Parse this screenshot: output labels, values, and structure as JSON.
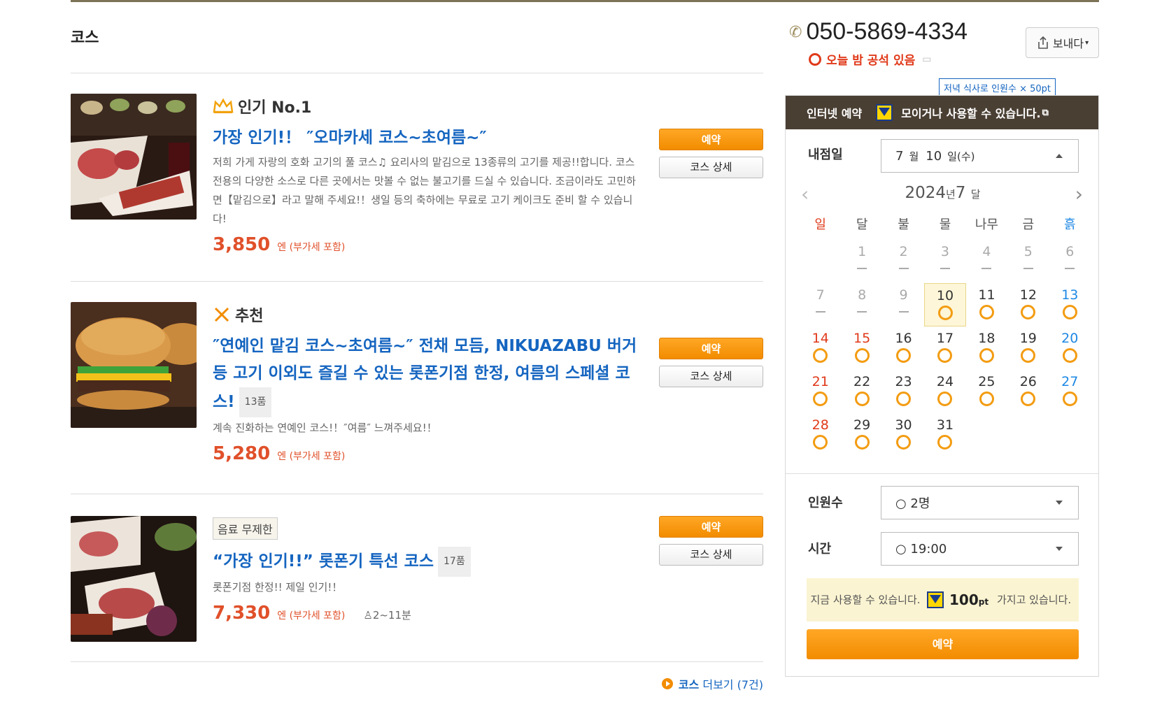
{
  "section": {
    "title": "코스"
  },
  "courses": [
    {
      "badge": "인기 No.1",
      "title": "가장 인기!！ ″오마카세 코스~초여름~″",
      "count": "",
      "desc": "저희 가게 자랑의 호화 고기의 풀 코스♫ 요리사의 맡김으로 13종류의 고기를 제공!!합니다. 코스 전용의 다양한 소스로 다른 곳에서는 맛볼 수 없는 불고기를 드실 수 있습니다. 조금이라도 고민하면【맡김으로】라고 말해 주세요!！생일 등의 축하에는 무료로 고기 케이크도 준비 할 수 있습니다!",
      "price": "3,850",
      "tax": "엔 (부가세 포함)",
      "people": "",
      "reserve": "예약",
      "detail": "코스 상세"
    },
    {
      "badge": "추천",
      "title": "″연예인 맡김 코스~초여름~″ 전채 모듬, NIKUAZABU 버거 등 고기 이외도 즐길 수 있는 롯폰기점 한정, 여름의 스페셜 코스!",
      "count": "13품",
      "desc": "계속 진화하는 연예인 코스!！″여름″ 느껴주세요!！",
      "price": "5,280",
      "tax": "엔 (부가세 포함)",
      "people": "",
      "reserve": "예약",
      "detail": "코스 상세"
    },
    {
      "badge": "음료 무제한",
      "title": "“가장 인기!!” 롯폰기 특선 코스",
      "count": "17품",
      "desc": "롯폰기점 한정!! 제일 인기!！",
      "price": "7,330",
      "tax": "엔 (부가세 포함)",
      "people": "2~11분",
      "reserve": "예약",
      "detail": "코스 상세"
    }
  ],
  "more": {
    "label": "코스",
    "text": "더보기 (7건)"
  },
  "contact": {
    "phone": "050-5869-4334",
    "vacancy": "오늘 밤 공석 있음",
    "share": "보내다"
  },
  "tooltip": "저녁 식사로 인원수 × 50pt",
  "panel": {
    "head_left": "인터넷 예약",
    "head_right": "모이거나 사용할 수 있습니다.",
    "date_label": "내점일",
    "date_month": "7",
    "date_month_unit": "월",
    "date_day": "10",
    "date_day_unit": "일(수)",
    "cal_year": "2024",
    "cal_year_unit": "년",
    "cal_month": "7",
    "cal_month_unit": "달",
    "weekdays": [
      "일",
      "달",
      "불",
      "물",
      "나무",
      "금",
      "흙"
    ],
    "weeks": [
      [
        "",
        "1",
        "2",
        "3",
        "4",
        "5",
        "6"
      ],
      [
        "7",
        "8",
        "9",
        "10",
        "11",
        "12",
        "13"
      ],
      [
        "14",
        "15",
        "16",
        "17",
        "18",
        "19",
        "20"
      ],
      [
        "21",
        "22",
        "23",
        "24",
        "25",
        "26",
        "27"
      ],
      [
        "28",
        "29",
        "30",
        "31",
        "",
        "",
        ""
      ]
    ],
    "people_label": "인원수",
    "people_value": "○ 2명",
    "time_label": "시간",
    "time_value": "○ 19:00",
    "points_pre": "지금 사용할 수 있습니다.",
    "points_value": "100",
    "points_unit": "pt",
    "points_post": "가지고 있습니다.",
    "reserve": "예약"
  },
  "colors": {
    "accent": "#f28c00",
    "link": "#1565c0",
    "price": "#e0502a",
    "header": "#4a3f33"
  }
}
